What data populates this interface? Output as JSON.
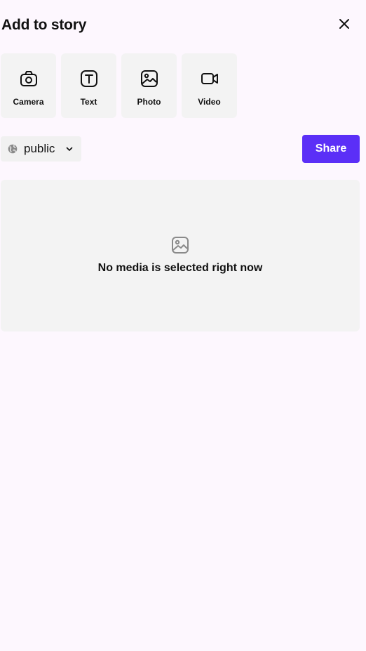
{
  "header": {
    "title": "Add to story",
    "close_icon": "close-icon"
  },
  "tiles": [
    {
      "label": "Camera",
      "icon": "camera-icon"
    },
    {
      "label": "Text",
      "icon": "text-icon"
    },
    {
      "label": "Photo",
      "icon": "photo-icon"
    },
    {
      "label": "Video",
      "icon": "video-icon"
    }
  ],
  "visibility": {
    "selected": "public",
    "icon": "globe-icon",
    "dropdown_icon": "chevron-down-icon"
  },
  "share": {
    "label": "Share",
    "color": "#5b2ff7"
  },
  "media": {
    "empty_message": "No media is selected right now",
    "icon": "image-placeholder-icon"
  },
  "colors": {
    "background": "#fdf7fe",
    "tile_background": "#f3f3f3",
    "accent": "#5b2ff7"
  }
}
